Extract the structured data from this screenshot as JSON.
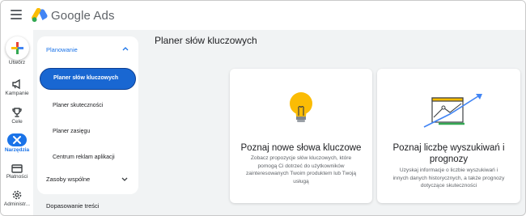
{
  "app": {
    "title": "Google Ads"
  },
  "rail": {
    "create": "Utwórz",
    "campaigns": "Kampanie",
    "goals": "Cele",
    "tools": "Narzędzia",
    "billing": "Płatności",
    "admin": "Administr..."
  },
  "nav": {
    "section": "Planowanie",
    "items": [
      {
        "label": "Planer słów kluczowych",
        "selected": true
      },
      {
        "label": "Planer skuteczności"
      },
      {
        "label": "Planer zasięgu"
      },
      {
        "label": "Centrum reklam aplikacji"
      }
    ],
    "shared": "Zasoby wspólne",
    "content": "Dopasowanie treści"
  },
  "main": {
    "title": "Planer słów kluczowych",
    "cards": [
      {
        "title": "Poznaj nowe słowa kluczowe",
        "lines": [
          "Zobacz propozycje słów kluczowych, które",
          "pomogą Ci dotrzeć do użytkowników",
          "zainteresowanych Twoim produktem lub Twoją",
          "usługą"
        ]
      },
      {
        "title_lines": [
          "Poznaj liczbę wyszukiwań i",
          "prognozy"
        ],
        "lines": [
          "Uzyskaj informacje o liczbie wyszukiwań i",
          "innych danych historycznych, a także prognozy",
          "dotyczące skuteczności"
        ]
      }
    ]
  },
  "colors": {
    "accent": "#1a73e8",
    "selected": "#1967d2",
    "bulb": "#fbbc04",
    "chart_line": "#34a853"
  }
}
